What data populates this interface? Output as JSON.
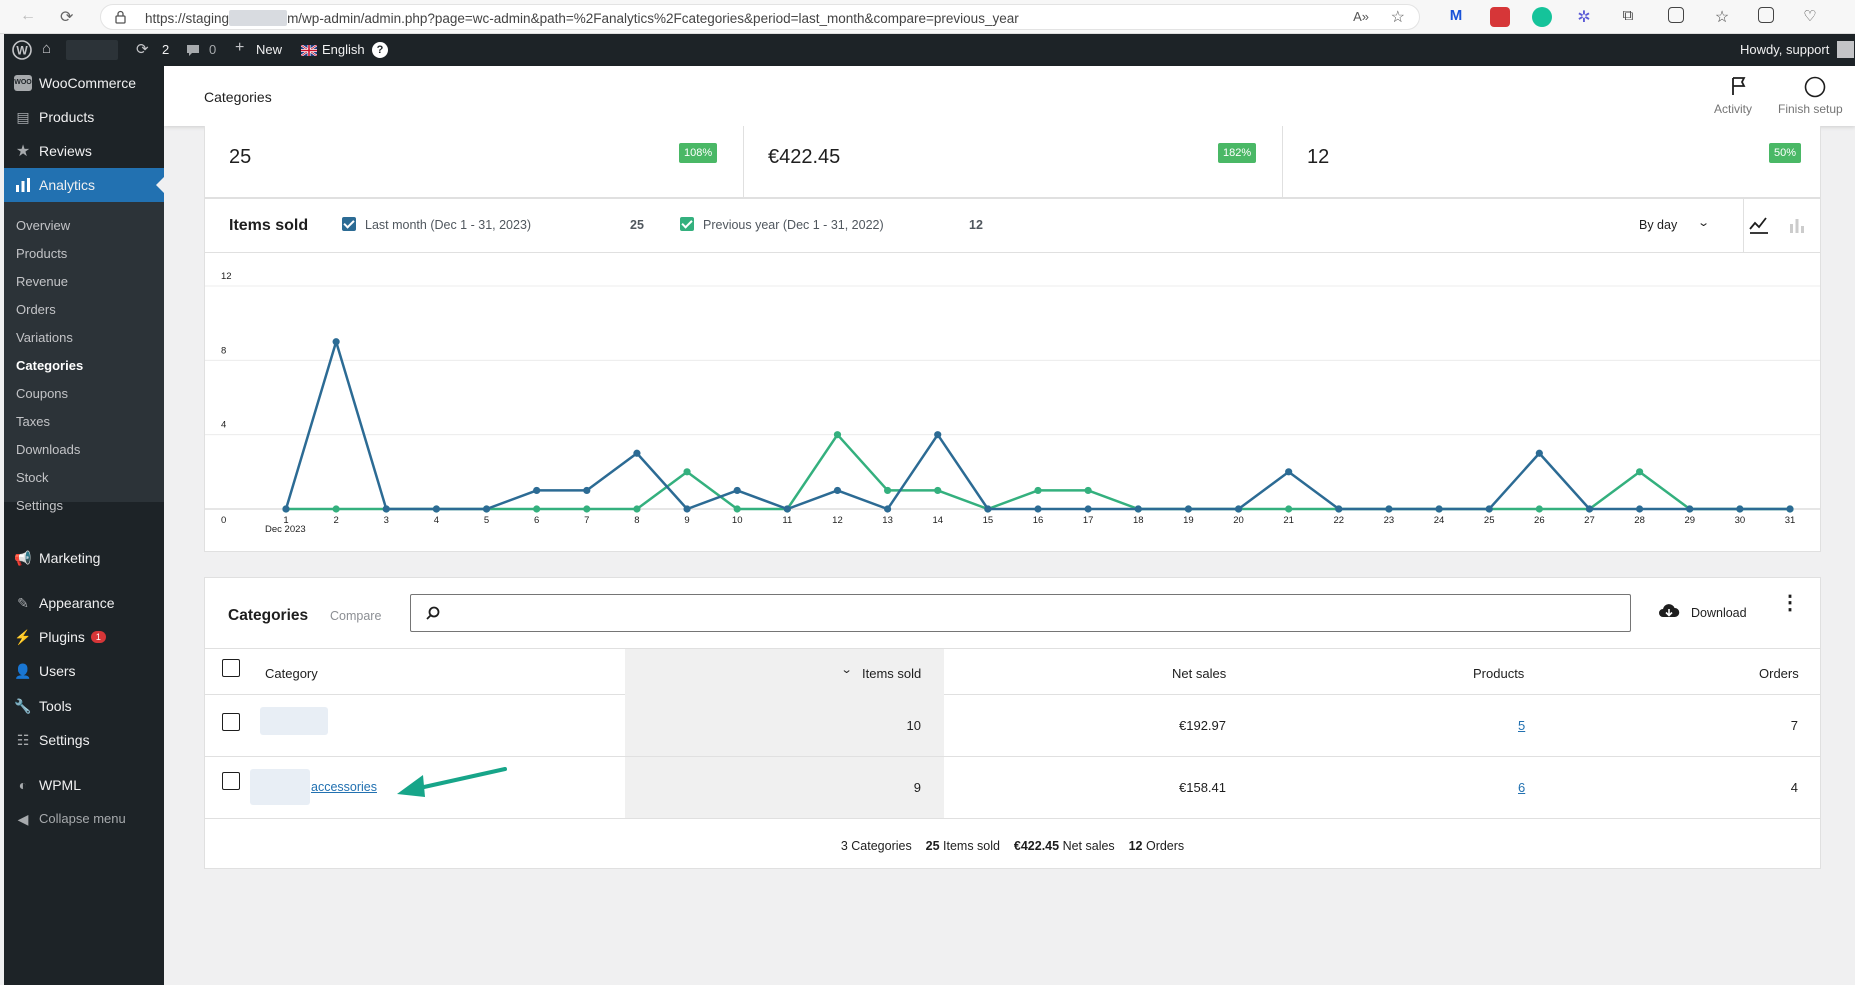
{
  "browser": {
    "url_prefix": "https://staging",
    "url_suffix": "m/wp-admin/admin.php?page=wc-admin&path=%2Fanalytics%2Fcategories&period=last_month&compare=previous_year"
  },
  "adminbar": {
    "updates_count": "2",
    "comments_count": "0",
    "new_label": "New",
    "language_label": "English",
    "howdy": "Howdy, support"
  },
  "sidebar": {
    "woocommerce": "WooCommerce",
    "products": "Products",
    "reviews": "Reviews",
    "analytics": "Analytics",
    "sub": [
      "Overview",
      "Products",
      "Revenue",
      "Orders",
      "Variations",
      "Categories",
      "Coupons",
      "Taxes",
      "Downloads",
      "Stock",
      "Settings"
    ],
    "marketing": "Marketing",
    "appearance": "Appearance",
    "plugins": "Plugins",
    "plugins_badge": "1",
    "users": "Users",
    "tools": "Tools",
    "settings": "Settings",
    "wpml": "WPML",
    "collapse": "Collapse menu"
  },
  "header": {
    "title": "Categories",
    "activity_label": "Activity",
    "finish_setup_label": "Finish setup"
  },
  "summary": [
    {
      "value": "25",
      "change": "108%"
    },
    {
      "value": "€422.45",
      "change": "182%"
    },
    {
      "value": "12",
      "change": "50%"
    }
  ],
  "chart_panel": {
    "title": "Items sold",
    "legend_primary": "Last month (Dec 1 - 31, 2023)",
    "legend_primary_total": "25",
    "legend_secondary": "Previous year (Dec 1 - 31, 2022)",
    "legend_secondary_total": "12",
    "interval_label": "By day",
    "x_month_label": "Dec 2023"
  },
  "chart_data": {
    "type": "line",
    "x": [
      1,
      2,
      3,
      4,
      5,
      6,
      7,
      8,
      9,
      10,
      11,
      12,
      13,
      14,
      15,
      16,
      17,
      18,
      19,
      20,
      21,
      22,
      23,
      24,
      25,
      26,
      27,
      28,
      29,
      30,
      31
    ],
    "y_ticks": [
      0,
      4,
      8,
      12
    ],
    "ylim": [
      0,
      12
    ],
    "series": [
      {
        "name": "Last month (Dec 1 - 31, 2023)",
        "color": "#2c6b94",
        "values": [
          0,
          9,
          0,
          0,
          0,
          1,
          1,
          3,
          0,
          1,
          0,
          1,
          0,
          4,
          0,
          0,
          0,
          0,
          0,
          0,
          2,
          0,
          0,
          0,
          0,
          3,
          0,
          0,
          0,
          0,
          0
        ]
      },
      {
        "name": "Previous year (Dec 1 - 31, 2022)",
        "color": "#34b07e",
        "values": [
          0,
          0,
          0,
          0,
          0,
          0,
          0,
          0,
          2,
          0,
          0,
          4,
          1,
          1,
          0,
          1,
          1,
          0,
          0,
          0,
          0,
          0,
          0,
          0,
          0,
          0,
          0,
          2,
          0,
          0,
          0
        ]
      }
    ]
  },
  "table_panel": {
    "title": "Categories",
    "compare_label": "Compare",
    "download_label": "Download",
    "columns": [
      "Category",
      "Items sold",
      "Net sales",
      "Products",
      "Orders"
    ],
    "rows": [
      {
        "category": "",
        "items_sold": "10",
        "net_sales": "€192.97",
        "products": "5",
        "orders": "7"
      },
      {
        "category": "accessories",
        "items_sold": "9",
        "net_sales": "€158.41",
        "products": "6",
        "orders": "4"
      }
    ],
    "footer": {
      "categories_count": "3",
      "categories_label": "Categories",
      "items_sold": "25",
      "items_sold_label": "Items sold",
      "net_sales": "€422.45",
      "net_sales_label": "Net sales",
      "orders": "12",
      "orders_label": "Orders"
    }
  }
}
